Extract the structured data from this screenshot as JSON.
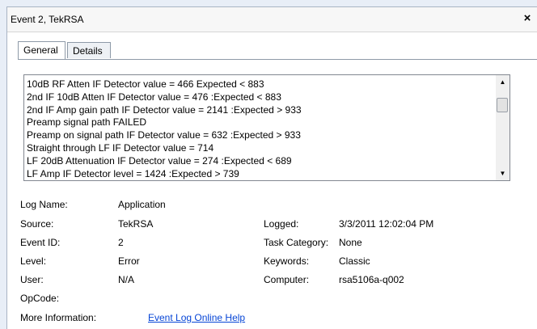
{
  "window": {
    "title": "Event 2, TekRSA",
    "close_glyph": "×"
  },
  "tabs": [
    {
      "label": "General",
      "active": true
    },
    {
      "label": "Details",
      "active": false
    }
  ],
  "description": {
    "lines": [
      "10dB RF Atten IF Detector value = 466  Expected < 883",
      "2nd IF 10dB Atten IF Detector value = 476  :Expected < 883",
      "2nd IF Amp gain path IF Detector value = 2141  :Expected > 933",
      "Preamp signal path FAILED",
      "Preamp on signal path IF Detector value = 632  :Expected > 933",
      "Straight through LF IF Detector value = 714",
      "LF 20dB Attenuation IF Detector value = 274  :Expected < 689",
      "LF Amp IF Detector level = 1424  :Expected > 739"
    ],
    "scroll_up_glyph": "▲",
    "scroll_down_glyph": "▼"
  },
  "details": {
    "log_name": {
      "label": "Log Name:",
      "value": "Application"
    },
    "source": {
      "label": "Source:",
      "value": "TekRSA"
    },
    "logged": {
      "label": "Logged:",
      "value": "3/3/2011 12:02:04 PM"
    },
    "event_id": {
      "label": "Event ID:",
      "value": "2"
    },
    "task_category": {
      "label": "Task Category:",
      "value": "None"
    },
    "level": {
      "label": "Level:",
      "value": "Error"
    },
    "keywords": {
      "label": "Keywords:",
      "value": "Classic"
    },
    "user": {
      "label": "User:",
      "value": "N/A"
    },
    "computer": {
      "label": "Computer:",
      "value": "rsa5106a-q002"
    },
    "opcode": {
      "label": "OpCode:",
      "value": ""
    },
    "more_info": {
      "label": "More Information:",
      "value": "Event Log Online Help"
    }
  }
}
